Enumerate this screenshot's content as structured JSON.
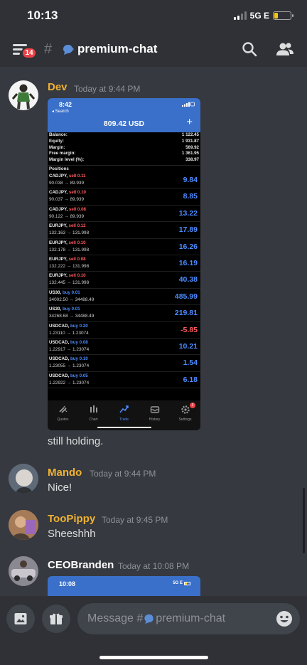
{
  "status_bar": {
    "time": "10:13",
    "network": "5G E"
  },
  "header": {
    "badge": "14",
    "channel": "premium-chat"
  },
  "composer": {
    "placeholder_prefix": "Message #",
    "placeholder_channel": "premium-chat"
  },
  "messages": [
    {
      "author": "Dev",
      "author_color": "#f0b232",
      "time": "Today at 9:44 PM",
      "text": "still holding."
    },
    {
      "author": "Mando",
      "author_color": "#f0b232",
      "time": "Today at 9:44 PM",
      "text": "Nice!"
    },
    {
      "author": "TooPippy",
      "author_color": "#f0b232",
      "time": "Today at 9:45 PM",
      "text": "Sheeshhh"
    },
    {
      "author": "CEOBranden",
      "author_color": "#ffffff",
      "time": "Today at 10:08 PM"
    }
  ],
  "attachment": {
    "time": "8:42",
    "back": "◂ Search",
    "title": "809.42 USD",
    "summary": [
      {
        "label": "Balance:",
        "value": "1 122.45"
      },
      {
        "label": "Equity:",
        "value": "1 931.87"
      },
      {
        "label": "Margin:",
        "value": "569.92"
      },
      {
        "label": "Free margin:",
        "value": "1 361.95"
      },
      {
        "label": "Margin level (%):",
        "value": "338.97"
      }
    ],
    "positions_heading": "Positions",
    "positions": [
      {
        "symbol": "CADJPY,",
        "side": "sell 0.11",
        "prices": "90.038 → 89.939",
        "pl": "9.84"
      },
      {
        "symbol": "CADJPY,",
        "side": "sell 0.10",
        "prices": "90.037 → 89.939",
        "pl": "8.85"
      },
      {
        "symbol": "CADJPY,",
        "side": "sell 0.08",
        "prices": "90.122 → 89.939",
        "pl": "13.22"
      },
      {
        "symbol": "EURJPY,",
        "side": "sell 0.12",
        "prices": "132.163 → 131.998",
        "pl": "17.89"
      },
      {
        "symbol": "EURJPY,",
        "side": "sell 0.10",
        "prices": "132.178 → 131.998",
        "pl": "16.26"
      },
      {
        "symbol": "EURJPY,",
        "side": "sell 0.08",
        "prices": "132.222 → 131.998",
        "pl": "16.19"
      },
      {
        "symbol": "EURJPY,",
        "side": "sell 0.10",
        "prices": "132.445 → 131.998",
        "pl": "40.38"
      },
      {
        "symbol": "US30,",
        "side": "buy 0.01",
        "prices": "34002.50 → 34488.49",
        "pl": "485.99"
      },
      {
        "symbol": "US30,",
        "side": "buy 0.01",
        "prices": "34268.68 → 34488.49",
        "pl": "219.81"
      },
      {
        "symbol": "USDCAD,",
        "side": "buy 0.20",
        "prices": "1.23110 → 1.23074",
        "pl": "-5.85"
      },
      {
        "symbol": "USDCAD,",
        "side": "buy 0.08",
        "prices": "1.22917 → 1.23074",
        "pl": "10.21"
      },
      {
        "symbol": "USDCAD,",
        "side": "buy 0.10",
        "prices": "1.23055 → 1.23074",
        "pl": "1.54"
      },
      {
        "symbol": "USDCAD,",
        "side": "buy 0.05",
        "prices": "1.22922 → 1.23074",
        "pl": "6.18"
      }
    ],
    "tabs": [
      {
        "label": "Quotes",
        "icon": "quotes-icon"
      },
      {
        "label": "Chart",
        "icon": "chart-icon"
      },
      {
        "label": "Trade",
        "icon": "trade-icon",
        "active": true
      },
      {
        "label": "History",
        "icon": "history-icon"
      },
      {
        "label": "Settings",
        "icon": "settings-icon",
        "badge": "3"
      }
    ]
  },
  "attachment2": {
    "time": "10:08",
    "network": "5G E"
  },
  "colors": {
    "background": "#36393f",
    "header": "#2f3136",
    "accent_blue": "#3a70c9",
    "sell": "#ff5c5c",
    "buy": "#4d8bff"
  }
}
